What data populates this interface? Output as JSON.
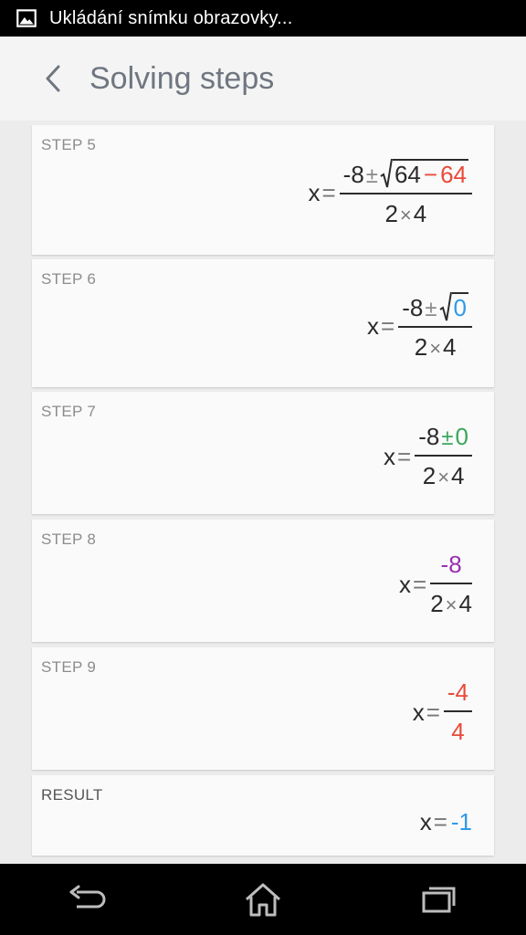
{
  "status_bar": {
    "notification_text": "Ukládání snímku obrazovky..."
  },
  "app_bar": {
    "title": "Solving steps"
  },
  "steps": [
    {
      "label": "STEP 5",
      "x": "x",
      "eq": "=",
      "num_left": "-8",
      "pm": "±",
      "rad_a": "64",
      "minus": "−",
      "rad_b": "64",
      "den_a": "2",
      "times": "×",
      "den_b": "4"
    },
    {
      "label": "STEP 6",
      "x": "x",
      "eq": "=",
      "num_left": "-8",
      "pm": "±",
      "rad": "0",
      "den_a": "2",
      "times": "×",
      "den_b": "4"
    },
    {
      "label": "STEP 7",
      "x": "x",
      "eq": "=",
      "num_left": "-8",
      "pm": "±",
      "num_right": "0",
      "den_a": "2",
      "times": "×",
      "den_b": "4"
    },
    {
      "label": "STEP 8",
      "x": "x",
      "eq": "=",
      "num": "-8",
      "den_a": "2",
      "times": "×",
      "den_b": "4"
    },
    {
      "label": "STEP 9",
      "x": "x",
      "eq": "=",
      "num": "-4",
      "den": "4"
    }
  ],
  "result": {
    "label": "RESULT",
    "x": "x",
    "eq": "=",
    "value": "-1"
  },
  "colors": {
    "red": "#e84a3a",
    "blue": "#2f9be8",
    "green": "#3aa65a",
    "purple": "#9a2fb0",
    "title": "#6f7680"
  },
  "icons": {
    "status": "image-icon",
    "back": "chevron-left-icon",
    "nav_back": "back-arrow-icon",
    "nav_home": "home-icon",
    "nav_recents": "recent-apps-icon"
  }
}
